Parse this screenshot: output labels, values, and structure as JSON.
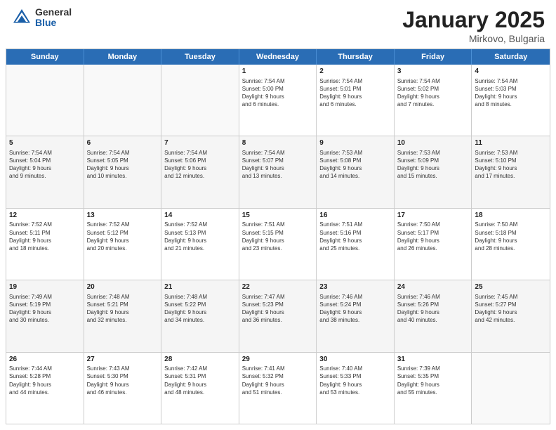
{
  "logo": {
    "general": "General",
    "blue": "Blue"
  },
  "title": {
    "month": "January 2025",
    "location": "Mirkovo, Bulgaria"
  },
  "weekdays": [
    "Sunday",
    "Monday",
    "Tuesday",
    "Wednesday",
    "Thursday",
    "Friday",
    "Saturday"
  ],
  "weeks": [
    [
      {
        "day": "",
        "info": ""
      },
      {
        "day": "",
        "info": ""
      },
      {
        "day": "",
        "info": ""
      },
      {
        "day": "1",
        "info": "Sunrise: 7:54 AM\nSunset: 5:00 PM\nDaylight: 9 hours\nand 6 minutes."
      },
      {
        "day": "2",
        "info": "Sunrise: 7:54 AM\nSunset: 5:01 PM\nDaylight: 9 hours\nand 6 minutes."
      },
      {
        "day": "3",
        "info": "Sunrise: 7:54 AM\nSunset: 5:02 PM\nDaylight: 9 hours\nand 7 minutes."
      },
      {
        "day": "4",
        "info": "Sunrise: 7:54 AM\nSunset: 5:03 PM\nDaylight: 9 hours\nand 8 minutes."
      }
    ],
    [
      {
        "day": "5",
        "info": "Sunrise: 7:54 AM\nSunset: 5:04 PM\nDaylight: 9 hours\nand 9 minutes."
      },
      {
        "day": "6",
        "info": "Sunrise: 7:54 AM\nSunset: 5:05 PM\nDaylight: 9 hours\nand 10 minutes."
      },
      {
        "day": "7",
        "info": "Sunrise: 7:54 AM\nSunset: 5:06 PM\nDaylight: 9 hours\nand 12 minutes."
      },
      {
        "day": "8",
        "info": "Sunrise: 7:54 AM\nSunset: 5:07 PM\nDaylight: 9 hours\nand 13 minutes."
      },
      {
        "day": "9",
        "info": "Sunrise: 7:53 AM\nSunset: 5:08 PM\nDaylight: 9 hours\nand 14 minutes."
      },
      {
        "day": "10",
        "info": "Sunrise: 7:53 AM\nSunset: 5:09 PM\nDaylight: 9 hours\nand 15 minutes."
      },
      {
        "day": "11",
        "info": "Sunrise: 7:53 AM\nSunset: 5:10 PM\nDaylight: 9 hours\nand 17 minutes."
      }
    ],
    [
      {
        "day": "12",
        "info": "Sunrise: 7:52 AM\nSunset: 5:11 PM\nDaylight: 9 hours\nand 18 minutes."
      },
      {
        "day": "13",
        "info": "Sunrise: 7:52 AM\nSunset: 5:12 PM\nDaylight: 9 hours\nand 20 minutes."
      },
      {
        "day": "14",
        "info": "Sunrise: 7:52 AM\nSunset: 5:13 PM\nDaylight: 9 hours\nand 21 minutes."
      },
      {
        "day": "15",
        "info": "Sunrise: 7:51 AM\nSunset: 5:15 PM\nDaylight: 9 hours\nand 23 minutes."
      },
      {
        "day": "16",
        "info": "Sunrise: 7:51 AM\nSunset: 5:16 PM\nDaylight: 9 hours\nand 25 minutes."
      },
      {
        "day": "17",
        "info": "Sunrise: 7:50 AM\nSunset: 5:17 PM\nDaylight: 9 hours\nand 26 minutes."
      },
      {
        "day": "18",
        "info": "Sunrise: 7:50 AM\nSunset: 5:18 PM\nDaylight: 9 hours\nand 28 minutes."
      }
    ],
    [
      {
        "day": "19",
        "info": "Sunrise: 7:49 AM\nSunset: 5:19 PM\nDaylight: 9 hours\nand 30 minutes."
      },
      {
        "day": "20",
        "info": "Sunrise: 7:48 AM\nSunset: 5:21 PM\nDaylight: 9 hours\nand 32 minutes."
      },
      {
        "day": "21",
        "info": "Sunrise: 7:48 AM\nSunset: 5:22 PM\nDaylight: 9 hours\nand 34 minutes."
      },
      {
        "day": "22",
        "info": "Sunrise: 7:47 AM\nSunset: 5:23 PM\nDaylight: 9 hours\nand 36 minutes."
      },
      {
        "day": "23",
        "info": "Sunrise: 7:46 AM\nSunset: 5:24 PM\nDaylight: 9 hours\nand 38 minutes."
      },
      {
        "day": "24",
        "info": "Sunrise: 7:46 AM\nSunset: 5:26 PM\nDaylight: 9 hours\nand 40 minutes."
      },
      {
        "day": "25",
        "info": "Sunrise: 7:45 AM\nSunset: 5:27 PM\nDaylight: 9 hours\nand 42 minutes."
      }
    ],
    [
      {
        "day": "26",
        "info": "Sunrise: 7:44 AM\nSunset: 5:28 PM\nDaylight: 9 hours\nand 44 minutes."
      },
      {
        "day": "27",
        "info": "Sunrise: 7:43 AM\nSunset: 5:30 PM\nDaylight: 9 hours\nand 46 minutes."
      },
      {
        "day": "28",
        "info": "Sunrise: 7:42 AM\nSunset: 5:31 PM\nDaylight: 9 hours\nand 48 minutes."
      },
      {
        "day": "29",
        "info": "Sunrise: 7:41 AM\nSunset: 5:32 PM\nDaylight: 9 hours\nand 51 minutes."
      },
      {
        "day": "30",
        "info": "Sunrise: 7:40 AM\nSunset: 5:33 PM\nDaylight: 9 hours\nand 53 minutes."
      },
      {
        "day": "31",
        "info": "Sunrise: 7:39 AM\nSunset: 5:35 PM\nDaylight: 9 hours\nand 55 minutes."
      },
      {
        "day": "",
        "info": ""
      }
    ]
  ]
}
